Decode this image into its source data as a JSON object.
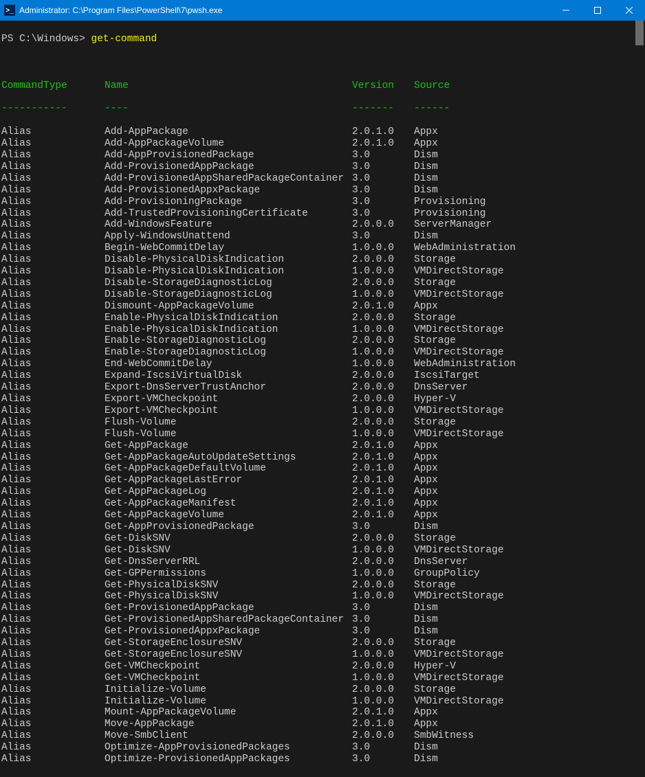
{
  "titlebar": {
    "icon_glyph": ">_",
    "title": "Administrator: C:\\Program Files\\PowerShell\\7\\pwsh.exe"
  },
  "prompt": {
    "path": "PS C:\\Windows>",
    "command": "get-command"
  },
  "headers": {
    "type": "CommandType",
    "name": "Name",
    "version": "Version",
    "source": "Source"
  },
  "dashes": {
    "type": "-----------",
    "name": "----",
    "version": "-------",
    "source": "------"
  },
  "rows": [
    {
      "type": "Alias",
      "name": "Add-AppPackage",
      "version": "2.0.1.0",
      "source": "Appx"
    },
    {
      "type": "Alias",
      "name": "Add-AppPackageVolume",
      "version": "2.0.1.0",
      "source": "Appx"
    },
    {
      "type": "Alias",
      "name": "Add-AppProvisionedPackage",
      "version": "3.0",
      "source": "Dism"
    },
    {
      "type": "Alias",
      "name": "Add-ProvisionedAppPackage",
      "version": "3.0",
      "source": "Dism"
    },
    {
      "type": "Alias",
      "name": "Add-ProvisionedAppSharedPackageContainer",
      "version": "3.0",
      "source": "Dism"
    },
    {
      "type": "Alias",
      "name": "Add-ProvisionedAppxPackage",
      "version": "3.0",
      "source": "Dism"
    },
    {
      "type": "Alias",
      "name": "Add-ProvisioningPackage",
      "version": "3.0",
      "source": "Provisioning"
    },
    {
      "type": "Alias",
      "name": "Add-TrustedProvisioningCertificate",
      "version": "3.0",
      "source": "Provisioning"
    },
    {
      "type": "Alias",
      "name": "Add-WindowsFeature",
      "version": "2.0.0.0",
      "source": "ServerManager"
    },
    {
      "type": "Alias",
      "name": "Apply-WindowsUnattend",
      "version": "3.0",
      "source": "Dism"
    },
    {
      "type": "Alias",
      "name": "Begin-WebCommitDelay",
      "version": "1.0.0.0",
      "source": "WebAdministration"
    },
    {
      "type": "Alias",
      "name": "Disable-PhysicalDiskIndication",
      "version": "2.0.0.0",
      "source": "Storage"
    },
    {
      "type": "Alias",
      "name": "Disable-PhysicalDiskIndication",
      "version": "1.0.0.0",
      "source": "VMDirectStorage"
    },
    {
      "type": "Alias",
      "name": "Disable-StorageDiagnosticLog",
      "version": "2.0.0.0",
      "source": "Storage"
    },
    {
      "type": "Alias",
      "name": "Disable-StorageDiagnosticLog",
      "version": "1.0.0.0",
      "source": "VMDirectStorage"
    },
    {
      "type": "Alias",
      "name": "Dismount-AppPackageVolume",
      "version": "2.0.1.0",
      "source": "Appx"
    },
    {
      "type": "Alias",
      "name": "Enable-PhysicalDiskIndication",
      "version": "2.0.0.0",
      "source": "Storage"
    },
    {
      "type": "Alias",
      "name": "Enable-PhysicalDiskIndication",
      "version": "1.0.0.0",
      "source": "VMDirectStorage"
    },
    {
      "type": "Alias",
      "name": "Enable-StorageDiagnosticLog",
      "version": "2.0.0.0",
      "source": "Storage"
    },
    {
      "type": "Alias",
      "name": "Enable-StorageDiagnosticLog",
      "version": "1.0.0.0",
      "source": "VMDirectStorage"
    },
    {
      "type": "Alias",
      "name": "End-WebCommitDelay",
      "version": "1.0.0.0",
      "source": "WebAdministration"
    },
    {
      "type": "Alias",
      "name": "Expand-IscsiVirtualDisk",
      "version": "2.0.0.0",
      "source": "IscsiTarget"
    },
    {
      "type": "Alias",
      "name": "Export-DnsServerTrustAnchor",
      "version": "2.0.0.0",
      "source": "DnsServer"
    },
    {
      "type": "Alias",
      "name": "Export-VMCheckpoint",
      "version": "2.0.0.0",
      "source": "Hyper-V"
    },
    {
      "type": "Alias",
      "name": "Export-VMCheckpoint",
      "version": "1.0.0.0",
      "source": "VMDirectStorage"
    },
    {
      "type": "Alias",
      "name": "Flush-Volume",
      "version": "2.0.0.0",
      "source": "Storage"
    },
    {
      "type": "Alias",
      "name": "Flush-Volume",
      "version": "1.0.0.0",
      "source": "VMDirectStorage"
    },
    {
      "type": "Alias",
      "name": "Get-AppPackage",
      "version": "2.0.1.0",
      "source": "Appx"
    },
    {
      "type": "Alias",
      "name": "Get-AppPackageAutoUpdateSettings",
      "version": "2.0.1.0",
      "source": "Appx"
    },
    {
      "type": "Alias",
      "name": "Get-AppPackageDefaultVolume",
      "version": "2.0.1.0",
      "source": "Appx"
    },
    {
      "type": "Alias",
      "name": "Get-AppPackageLastError",
      "version": "2.0.1.0",
      "source": "Appx"
    },
    {
      "type": "Alias",
      "name": "Get-AppPackageLog",
      "version": "2.0.1.0",
      "source": "Appx"
    },
    {
      "type": "Alias",
      "name": "Get-AppPackageManifest",
      "version": "2.0.1.0",
      "source": "Appx"
    },
    {
      "type": "Alias",
      "name": "Get-AppPackageVolume",
      "version": "2.0.1.0",
      "source": "Appx"
    },
    {
      "type": "Alias",
      "name": "Get-AppProvisionedPackage",
      "version": "3.0",
      "source": "Dism"
    },
    {
      "type": "Alias",
      "name": "Get-DiskSNV",
      "version": "2.0.0.0",
      "source": "Storage"
    },
    {
      "type": "Alias",
      "name": "Get-DiskSNV",
      "version": "1.0.0.0",
      "source": "VMDirectStorage"
    },
    {
      "type": "Alias",
      "name": "Get-DnsServerRRL",
      "version": "2.0.0.0",
      "source": "DnsServer"
    },
    {
      "type": "Alias",
      "name": "Get-GPPermissions",
      "version": "1.0.0.0",
      "source": "GroupPolicy"
    },
    {
      "type": "Alias",
      "name": "Get-PhysicalDiskSNV",
      "version": "2.0.0.0",
      "source": "Storage"
    },
    {
      "type": "Alias",
      "name": "Get-PhysicalDiskSNV",
      "version": "1.0.0.0",
      "source": "VMDirectStorage"
    },
    {
      "type": "Alias",
      "name": "Get-ProvisionedAppPackage",
      "version": "3.0",
      "source": "Dism"
    },
    {
      "type": "Alias",
      "name": "Get-ProvisionedAppSharedPackageContainer",
      "version": "3.0",
      "source": "Dism"
    },
    {
      "type": "Alias",
      "name": "Get-ProvisionedAppxPackage",
      "version": "3.0",
      "source": "Dism"
    },
    {
      "type": "Alias",
      "name": "Get-StorageEnclosureSNV",
      "version": "2.0.0.0",
      "source": "Storage"
    },
    {
      "type": "Alias",
      "name": "Get-StorageEnclosureSNV",
      "version": "1.0.0.0",
      "source": "VMDirectStorage"
    },
    {
      "type": "Alias",
      "name": "Get-VMCheckpoint",
      "version": "2.0.0.0",
      "source": "Hyper-V"
    },
    {
      "type": "Alias",
      "name": "Get-VMCheckpoint",
      "version": "1.0.0.0",
      "source": "VMDirectStorage"
    },
    {
      "type": "Alias",
      "name": "Initialize-Volume",
      "version": "2.0.0.0",
      "source": "Storage"
    },
    {
      "type": "Alias",
      "name": "Initialize-Volume",
      "version": "1.0.0.0",
      "source": "VMDirectStorage"
    },
    {
      "type": "Alias",
      "name": "Mount-AppPackageVolume",
      "version": "2.0.1.0",
      "source": "Appx"
    },
    {
      "type": "Alias",
      "name": "Move-AppPackage",
      "version": "2.0.1.0",
      "source": "Appx"
    },
    {
      "type": "Alias",
      "name": "Move-SmbClient",
      "version": "2.0.0.0",
      "source": "SmbWitness"
    },
    {
      "type": "Alias",
      "name": "Optimize-AppProvisionedPackages",
      "version": "3.0",
      "source": "Dism"
    },
    {
      "type": "Alias",
      "name": "Optimize-ProvisionedAppPackages",
      "version": "3.0",
      "source": "Dism"
    }
  ]
}
